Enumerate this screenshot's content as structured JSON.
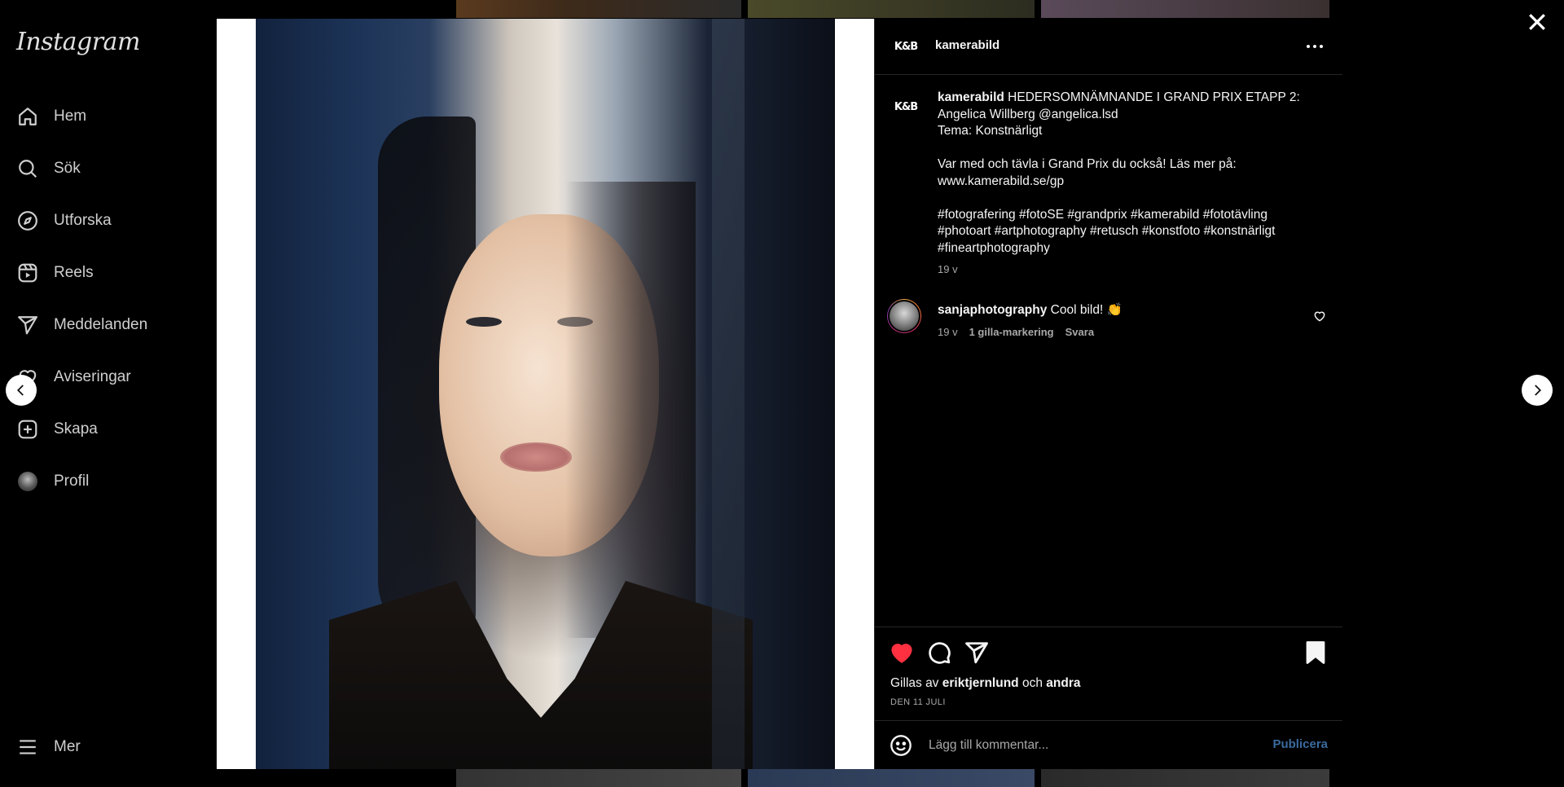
{
  "sidebar": {
    "logo": "Instagram",
    "items": [
      {
        "label": "Hem",
        "icon": "home-icon"
      },
      {
        "label": "Sök",
        "icon": "search-icon"
      },
      {
        "label": "Utforska",
        "icon": "compass-icon"
      },
      {
        "label": "Reels",
        "icon": "reels-icon"
      },
      {
        "label": "Meddelanden",
        "icon": "send-icon"
      },
      {
        "label": "Aviseringar",
        "icon": "heart-icon"
      },
      {
        "label": "Skapa",
        "icon": "plus-square-icon"
      },
      {
        "label": "Profil",
        "icon": "profile-avatar"
      }
    ],
    "more_label": "Mer"
  },
  "post": {
    "author": "kamerabild",
    "author_avatar_text": "K&B",
    "caption": {
      "username": "kamerabild",
      "line1": "HEDERSOMNÄMNANDE I GRAND PRIX ETAPP 2:",
      "line2": "Angelica Willberg @angelica.lsd",
      "line3": "Tema: Konstnärligt",
      "line4": "Var med och tävla i Grand Prix du också! Läs mer på:",
      "line5": "www.kamerabild.se/gp",
      "hashtags_line1": "#fotografering #fotoSE #grandprix #kamerabild #fototävling",
      "hashtags_line2": "#photoart #artphotography #retusch #konstfoto #konstnärligt",
      "hashtags_line3": "#fineartphotography",
      "time": "19 v"
    },
    "comments": [
      {
        "username": "sanjaphotography",
        "text": "Cool bild! 👏",
        "time": "19 v",
        "likes": "1 gilla-markering",
        "reply_label": "Svara"
      }
    ],
    "liked": true,
    "likes_prefix": "Gillas av",
    "likes_user": "eriktjernlund",
    "likes_and": "och",
    "likes_others": "andra",
    "date": "DEN 11 JULI",
    "comment_placeholder": "Lägg till kommentar...",
    "publish_label": "Publicera"
  },
  "colors": {
    "like_red": "#ff3040",
    "publish_blue": "#3a6b9e"
  }
}
